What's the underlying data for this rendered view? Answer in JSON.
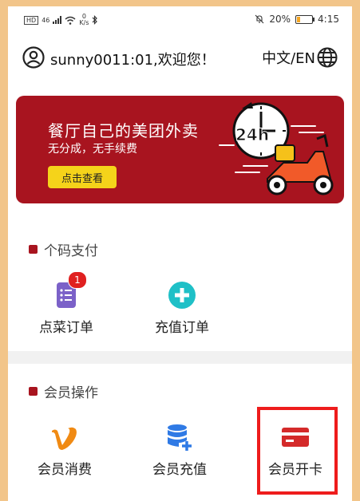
{
  "status_bar": {
    "hd": "HD",
    "network": "46",
    "speed_value": "0",
    "speed_unit": "K/s",
    "battery_percent": "20%",
    "battery_level": 0.2,
    "time": "4:15"
  },
  "user": {
    "name": "sunny0011:01,欢迎您！"
  },
  "language": {
    "label": "中文/EN"
  },
  "banner": {
    "title": "餐厅自己的美团外卖",
    "subtitle": "无分成，无手续费",
    "button": "点击查看",
    "badge_text": "24h",
    "colors": {
      "background": "#a8141f",
      "button": "#f5d31a",
      "scooter": "#f15a29"
    }
  },
  "sections": {
    "payment": {
      "title": "个码支付",
      "items": [
        {
          "label": "点菜订单",
          "icon": "list-icon",
          "badge": "1",
          "color": "#7b61c8"
        },
        {
          "label": "充值订单",
          "icon": "plus-circle-icon",
          "color": "#1fc0c7"
        }
      ]
    },
    "member": {
      "title": "会员操作",
      "items": [
        {
          "label": "会员消费",
          "icon": "v-logo-icon",
          "color": "#f08a13"
        },
        {
          "label": "会员充值",
          "icon": "database-add-icon",
          "color": "#2f7ae5"
        },
        {
          "label": "会员开卡",
          "icon": "credit-card-icon",
          "color": "#d42a2a"
        }
      ]
    }
  },
  "accent": "#a8141f"
}
